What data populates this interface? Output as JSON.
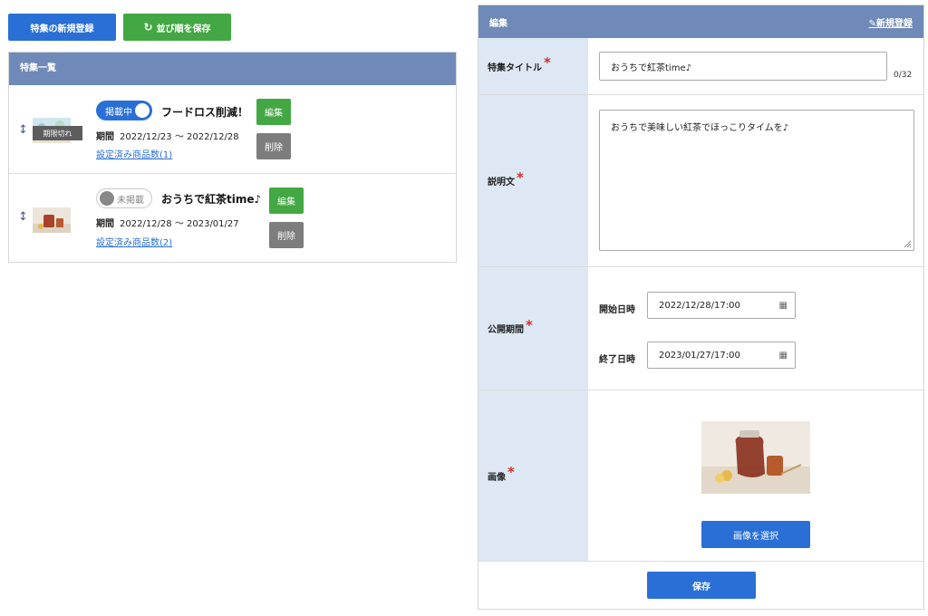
{
  "toolbar": {
    "new_label": "特集の新規登録",
    "save_order_label": "並び順を保存",
    "refresh_icon": "↻"
  },
  "list": {
    "header": "特集一覧",
    "edit_label": "編集",
    "delete_label": "削除",
    "period_label": "期間",
    "items": [
      {
        "status": "掲載中",
        "published": true,
        "title": "フードロス削減！",
        "period": "2022/12/23 ～ 2022/12/28",
        "products_link": "設定済み商品数(1)",
        "expired_badge": "期限切れ",
        "drag_icon": "↕"
      },
      {
        "status": "未掲載",
        "published": false,
        "title": "おうちで紅茶time♪",
        "period": "2022/12/28 ～ 2023/01/27",
        "products_link": "設定済み商品数(2)",
        "drag_icon": "↕"
      }
    ]
  },
  "edit": {
    "header": "編集",
    "new_link": "新規登録",
    "new_icon": "✎",
    "required_mark": "*",
    "title_label": "特集タイトル",
    "title_value": "おうちで紅茶time♪",
    "title_counter": "0/32",
    "desc_label": "説明文",
    "desc_value": "おうちで美味しい紅茶でほっこりタイムを♪",
    "period_label": "公開期間",
    "start_label": "開始日時",
    "start_value": "2022/12/28/17:00",
    "end_label": "終了日時",
    "end_value": "2023/01/27/17:00",
    "calendar_icon": "▦",
    "image_label": "画像",
    "select_image_label": "画像を選択",
    "save_label": "保存"
  },
  "colors": {
    "primary": "#2a6fd6",
    "success": "#43a843",
    "header": "#6f8ab8",
    "label_bg": "#dde8f4",
    "required": "#d0302b"
  }
}
